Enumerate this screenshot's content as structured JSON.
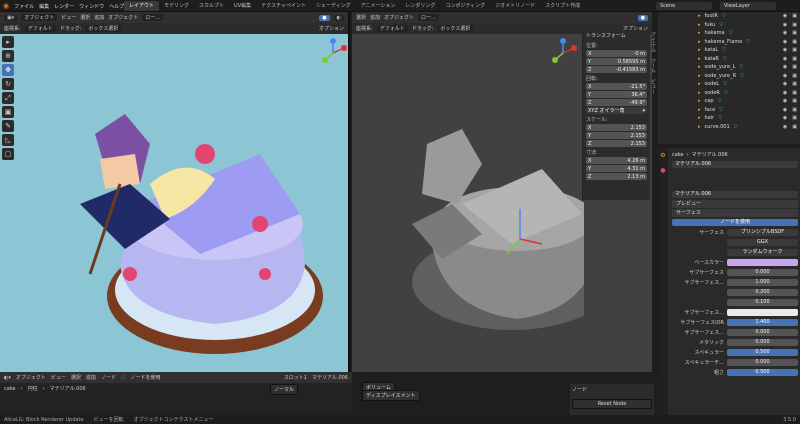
{
  "menu": [
    "ファイル",
    "編集",
    "レンダー",
    "ウィンドウ",
    "ヘルプ"
  ],
  "workspaces": [
    "レイアウト",
    "モデリング",
    "スカルプト",
    "UV編集",
    "テクスチャペイント",
    "シェーディング",
    "アニメーション",
    "レンダリング",
    "コンポジティング",
    "ジオメトリノード",
    "スクリプト作成"
  ],
  "scene": "Scene",
  "view_layer": "ViewLayer",
  "left_header": {
    "mode": "オブジェクト",
    "menus": [
      "ビュー",
      "選択",
      "追加",
      "オブジェクト"
    ],
    "transform": "ロー...",
    "options": "オプション"
  },
  "left_sub": {
    "orient": "座標系:",
    "default": "デフォルト",
    "drag": "ドラッグ:",
    "select": "ボックス選択"
  },
  "mid_sub": {
    "orient": "座標系:",
    "default": "デフォルト",
    "drag": "ドラッグ:",
    "select": "ボックス選択",
    "options": "オプション"
  },
  "mid_header": {
    "menus": [
      "選択",
      "追加",
      "オブジェクト"
    ],
    "transform": "ロー..."
  },
  "npanel": {
    "title": "トランスフォーム",
    "location": "位置:",
    "loc": [
      [
        "X",
        "-0 m"
      ],
      [
        "Y",
        "0.58595 m"
      ],
      [
        "Z",
        "-0.41583 m"
      ]
    ],
    "rotation": "回転:",
    "rot": [
      [
        "X",
        "-21.5°"
      ],
      [
        "Y",
        "36.4°"
      ],
      [
        "Z",
        "-49.9°"
      ]
    ],
    "mode": "XYZ オイラー角",
    "scale": "スケール:",
    "sc": [
      [
        "X",
        "2.153"
      ],
      [
        "Y",
        "2.153"
      ],
      [
        "Z",
        "2.153"
      ]
    ],
    "dims": "寸法:",
    "dim": [
      [
        "X",
        "4.26 m"
      ],
      [
        "Y",
        "4.31 m"
      ],
      [
        "Z",
        "2.13 m"
      ]
    ]
  },
  "outliner": [
    {
      "name": "footR"
    },
    {
      "name": "fuku"
    },
    {
      "name": "hakama"
    },
    {
      "name": "hakama_Flame"
    },
    {
      "name": "kataL"
    },
    {
      "name": "kataR"
    },
    {
      "name": "sode_yure_L"
    },
    {
      "name": "sode_yure_R"
    },
    {
      "name": "sodeL"
    },
    {
      "name": "sodeR"
    },
    {
      "name": "cap"
    },
    {
      "name": "face"
    },
    {
      "name": "hair"
    },
    {
      "name": "curve.001"
    }
  ],
  "props": {
    "breadcrumb": [
      "cake",
      "マテリアル.006"
    ],
    "slot": "マテリアル.006",
    "material": "マテリアル.006",
    "preview": "プレビュー",
    "surface_sect": "サーフェス",
    "use_nodes": "ノードを使用",
    "surface_label": "サーフェス",
    "surface_value": "プリンシプルBSDF",
    "distribution": "GGX",
    "subsurface_method": "ランダムウォーク",
    "rows": [
      {
        "k": "ベースカラー",
        "v": ""
      },
      {
        "k": "サブサーフェス",
        "v": "0.000"
      },
      {
        "k": "サブサーフェス...",
        "v": "1.000"
      },
      {
        "k": "",
        "v": "0.200"
      },
      {
        "k": "",
        "v": "0.100"
      },
      {
        "k": "サブサーフェス...",
        "v": ""
      },
      {
        "k": "サブサーフェスIOR",
        "v": "1.400"
      },
      {
        "k": "サブサーフェス...",
        "v": "0.000"
      },
      {
        "k": "メタリック",
        "v": "0.000"
      },
      {
        "k": "スペキュラー",
        "v": "0.500"
      },
      {
        "k": "スペキュラーチ...",
        "v": "0.000"
      },
      {
        "k": "粗さ",
        "v": "0.500"
      }
    ]
  },
  "bottom": {
    "mode": "オブジェクト",
    "menus": [
      "ビュー",
      "選択",
      "追加",
      "ノード"
    ],
    "use_nodes": "ノードを使用",
    "slot": "スロット1",
    "material": "マテリアル.006",
    "breadcrumb": [
      "cake",
      "円柱",
      "マテリアル.006"
    ],
    "node_panel": "ノード",
    "reset": "Reset Node",
    "node_normal": "ノーマル",
    "node_disp": "ディスプレイスメント",
    "node_out": "ボリューム"
  },
  "status": [
    "AliceLG: Block Renderer Update",
    "ビューを回転",
    "オブジェクトコンテクストメニュー"
  ],
  "version": "3.5.0"
}
